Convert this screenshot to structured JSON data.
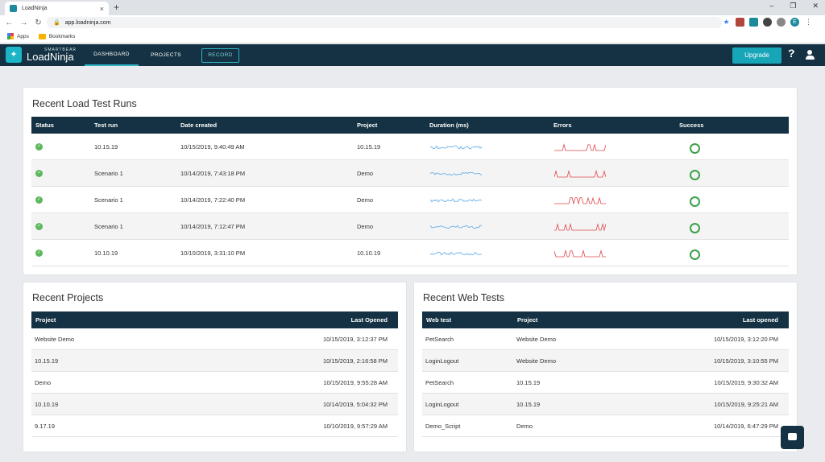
{
  "browser": {
    "tab_title": "LoadNinja",
    "tab_close": "×",
    "new_tab": "+",
    "window_controls": [
      "–",
      "❐",
      "✕"
    ],
    "url": "app.loadninja.com",
    "bookmarks": [
      "Apps",
      "Bookmarks"
    ],
    "profile_initial": "E"
  },
  "app": {
    "brand_small": "SMARTBEAR",
    "brand_name": "LoadNinja",
    "nav": [
      "DASHBOARD",
      "PROJECTS"
    ],
    "record_label": "RECORD",
    "upgrade_label": "Upgrade",
    "help_glyph": "?"
  },
  "recent_runs": {
    "title": "Recent Load Test Runs",
    "columns": [
      "Status",
      "Test run",
      "Date created",
      "Project",
      "Duration (ms)",
      "Errors",
      "Success"
    ],
    "rows": [
      {
        "test_run": "10.15.19",
        "date": "10/15/2019, 9:40:49 AM",
        "project": "10.15.19"
      },
      {
        "test_run": "Scenario 1",
        "date": "10/14/2019, 7:43:18 PM",
        "project": "Demo"
      },
      {
        "test_run": "Scenario 1",
        "date": "10/14/2019, 7:22:40 PM",
        "project": "Demo"
      },
      {
        "test_run": "Scenario 1",
        "date": "10/14/2019, 7:12:47 PM",
        "project": "Demo"
      },
      {
        "test_run": "10.10.19",
        "date": "10/10/2019, 3:31:10 PM",
        "project": "10.10.19"
      }
    ]
  },
  "recent_projects": {
    "title": "Recent Projects",
    "columns": [
      "Project",
      "Last Opened"
    ],
    "rows": [
      {
        "project": "Website Demo",
        "opened": "10/15/2019, 3:12:37 PM"
      },
      {
        "project": "10.15.19",
        "opened": "10/15/2019, 2:16:58 PM"
      },
      {
        "project": "Demo",
        "opened": "10/15/2019, 9:55:28 AM"
      },
      {
        "project": "10.10.19",
        "opened": "10/14/2019, 5:04:32 PM"
      },
      {
        "project": "9.17.19",
        "opened": "10/10/2019, 9:57:29 AM"
      }
    ]
  },
  "recent_web_tests": {
    "title": "Recent Web Tests",
    "columns": [
      "Web test",
      "Project",
      "Last opened"
    ],
    "rows": [
      {
        "test": "PetSearch",
        "project": "Website Demo",
        "opened": "10/15/2019, 3:12:20 PM"
      },
      {
        "test": "LoginLogout",
        "project": "Website Demo",
        "opened": "10/15/2019, 3:10:55 PM"
      },
      {
        "test": "PetSearch",
        "project": "10.15.19",
        "opened": "10/15/2019, 9:30:32 AM"
      },
      {
        "test": "LoginLogout",
        "project": "10.15.19",
        "opened": "10/15/2019, 9:25:21 AM"
      },
      {
        "test": "Demo_Script",
        "project": "Demo",
        "opened": "10/14/2019, 6:47:29 PM"
      }
    ]
  },
  "colors": {
    "header": "#143243",
    "accent": "#17a5b8",
    "success": "#5cb85c",
    "duration_line": "#5aa9e6",
    "error_line": "#e0474c"
  }
}
